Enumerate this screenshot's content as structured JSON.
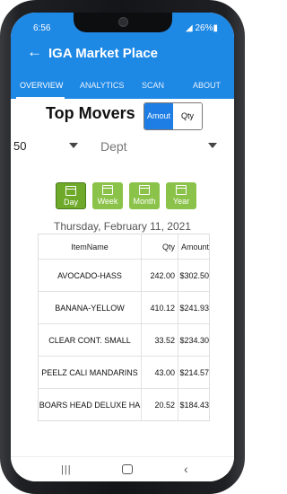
{
  "status": {
    "time": "6:56",
    "battery": "◢ 26%▮"
  },
  "appbar": {
    "back_icon": "←",
    "title": "IGA Market Place"
  },
  "tabs": [
    {
      "label": "OVERVIEW",
      "active": true
    },
    {
      "label": "ANALYTICS",
      "active": false
    },
    {
      "label": "SCAN",
      "active": false
    },
    {
      "label": "ABOUT",
      "active": false
    }
  ],
  "main": {
    "heading": "Top Movers",
    "toggle": {
      "amount_label": "Amout",
      "qty_label": "Qty",
      "selected": "Amout"
    },
    "count_select": "50",
    "dept_select": "Dept",
    "periods": [
      {
        "label": "Day",
        "active": true
      },
      {
        "label": "Week",
        "active": false
      },
      {
        "label": "Month",
        "active": false
      },
      {
        "label": "Year",
        "active": false
      }
    ],
    "date": "Thursday, February 11, 2021"
  },
  "table": {
    "columns": [
      "ItemName",
      "Qty",
      "Amount"
    ],
    "rows": [
      [
        "AVOCADO-HASS",
        "242.00",
        "$302.50"
      ],
      [
        "BANANA-YELLOW",
        "410.12",
        "$241.93"
      ],
      [
        "CLEAR CONT. SMALL",
        "33.52",
        "$234.30"
      ],
      [
        "PEELZ CALI MANDARINS",
        "43.00",
        "$214.57"
      ],
      [
        "BOARS HEAD DELUXE HA",
        "20.52",
        "$184.43"
      ]
    ]
  },
  "navbar": {
    "recents": "|||",
    "back": "‹"
  },
  "colors": {
    "primary": "#1e88e5",
    "period_green": "#8bc34a",
    "period_active": "#6ea92a"
  }
}
